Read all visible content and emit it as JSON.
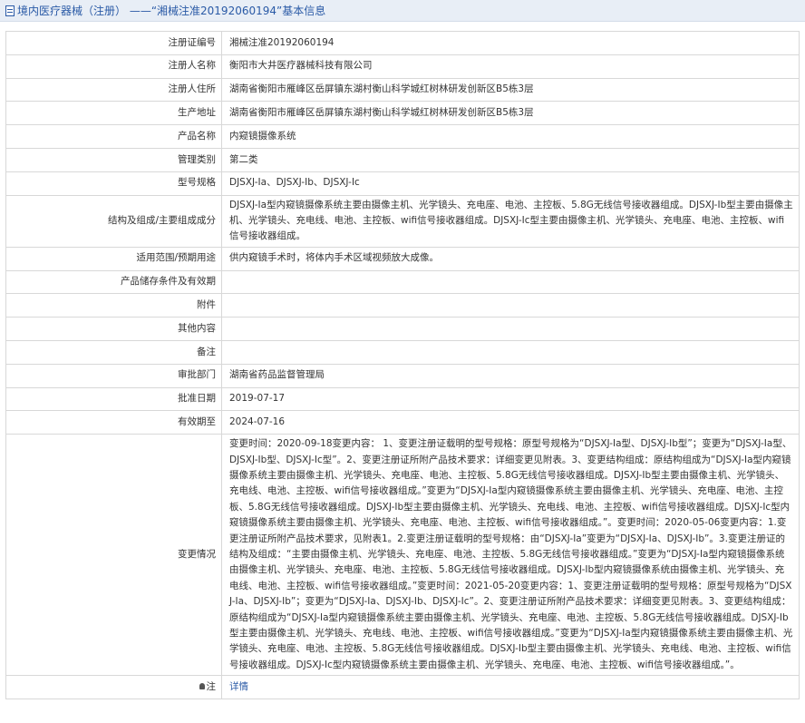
{
  "header": {
    "title": "境内医疗器械（注册） ——“湘械注准20192060194”基本信息"
  },
  "rows": [
    {
      "label": "注册证编号",
      "value": "湘械注准20192060194"
    },
    {
      "label": "注册人名称",
      "value": "衡阳市大井医疗器械科技有限公司"
    },
    {
      "label": "注册人住所",
      "value": "湖南省衡阳市雁峰区岳屏镇东湖村衡山科学城红树林研发创新区B5栋3层"
    },
    {
      "label": "生产地址",
      "value": "湖南省衡阳市雁峰区岳屏镇东湖村衡山科学城红树林研发创新区B5栋3层"
    },
    {
      "label": "产品名称",
      "value": "内窥镜摄像系统"
    },
    {
      "label": "管理类别",
      "value": "第二类"
    },
    {
      "label": "型号规格",
      "value": "DJSXJ-Ia、DJSXJ-Ib、DJSXJ-Ic"
    },
    {
      "label": "结构及组成/主要组成成分",
      "value": "DJSXJ-Ia型内窥镜摄像系统主要由摄像主机、光学镜头、充电座、电池、主控板、5.8G无线信号接收器组成。DJSXJ-Ib型主要由摄像主机、光学镜头、充电线、电池、主控板、wifi信号接收器组成。DJSXJ-Ic型主要由摄像主机、光学镜头、充电座、电池、主控板、wifi信号接收器组成。"
    },
    {
      "label": "适用范围/预期用途",
      "value": "供内窥镜手术时，将体内手术区域视频放大成像。"
    },
    {
      "label": "产品储存条件及有效期",
      "value": ""
    },
    {
      "label": "附件",
      "value": ""
    },
    {
      "label": "其他内容",
      "value": ""
    },
    {
      "label": "备注",
      "value": ""
    },
    {
      "label": "审批部门",
      "value": "湖南省药品监督管理局"
    },
    {
      "label": "批准日期",
      "value": "2019-07-17"
    },
    {
      "label": "有效期至",
      "value": "2024-07-16"
    },
    {
      "label": "变更情况",
      "value": "变更时间：2020-09-18变更内容： 1、变更注册证载明的型号规格：原型号规格为“DJSXJ-Ia型、DJSXJ-Ib型”；变更为“DJSXJ-Ia型、DJSXJ-Ib型、DJSXJ-Ic型”。2、变更注册证所附产品技术要求：详细变更见附表。3、变更结构组成：原结构组成为“DJSXJ-Ia型内窥镜摄像系统主要由摄像主机、光学镜头、充电座、电池、主控板、5.8G无线信号接收器组成。DJSXJ-Ib型主要由摄像主机、光学镜头、充电线、电池、主控板、wifi信号接收器组成。”变更为“DJSXJ-Ia型内窥镜摄像系统主要由摄像主机、光学镜头、充电座、电池、主控板、5.8G无线信号接收器组成。DJSXJ-Ib型主要由摄像主机、光学镜头、充电线、电池、主控板、wifi信号接收器组成。DJSXJ-Ic型内窥镜摄像系统主要由摄像主机、光学镜头、充电座、电池、主控板、wifi信号接收器组成。”。变更时间：2020-05-06变更内容：1.变更注册证所附产品技术要求，见附表1。2.变更注册证载明的型号规格：由“DJSXJ-Ia”变更为“DJSXJ-Ia、DJSXJ-Ib”。3.变更注册证的结构及组成：“主要由摄像主机、光学镜头、充电座、电池、主控板、5.8G无线信号接收器组成。”变更为“DJSXJ-Ia型内窥镜摄像系统由摄像主机、光学镜头、充电座、电池、主控板、5.8G无线信号接收器组成。DJSXJ-Ib型内窥镜摄像系统由摄像主机、光学镜头、充电线、电池、主控板、wifi信号接收器组成。”变更时间：2021-05-20变更内容：1、变更注册证载明的型号规格：原型号规格为“DJSXJ-Ia、DJSXJ-Ib”；变更为“DJSXJ-Ia、DJSXJ-Ib、DJSXJ-Ic”。2、变更注册证所附产品技术要求：详细变更见附表。3、变更结构组成：原结构组成为“DJSXJ-Ia型内窥镜摄像系统主要由摄像主机、光学镜头、充电座、电池、主控板、5.8G无线信号接收器组成。DJSXJ-Ib型主要由摄像主机、光学镜头、充电线、电池、主控板、wifi信号接收器组成。”变更为“DJSXJ-Ia型内窥镜摄像系统主要由摄像主机、光学镜头、充电座、电池、主控板、5.8G无线信号接收器组成。DJSXJ-Ib型主要由摄像主机、光学镜头、充电线、电池、主控板、wifi信号接收器组成。DJSXJ-Ic型内窥镜摄像系统主要由摄像主机、光学镜头、充电座、电池、主控板、wifi信号接收器组成。”。"
    }
  ],
  "note": {
    "label": "注",
    "link": "详情"
  }
}
